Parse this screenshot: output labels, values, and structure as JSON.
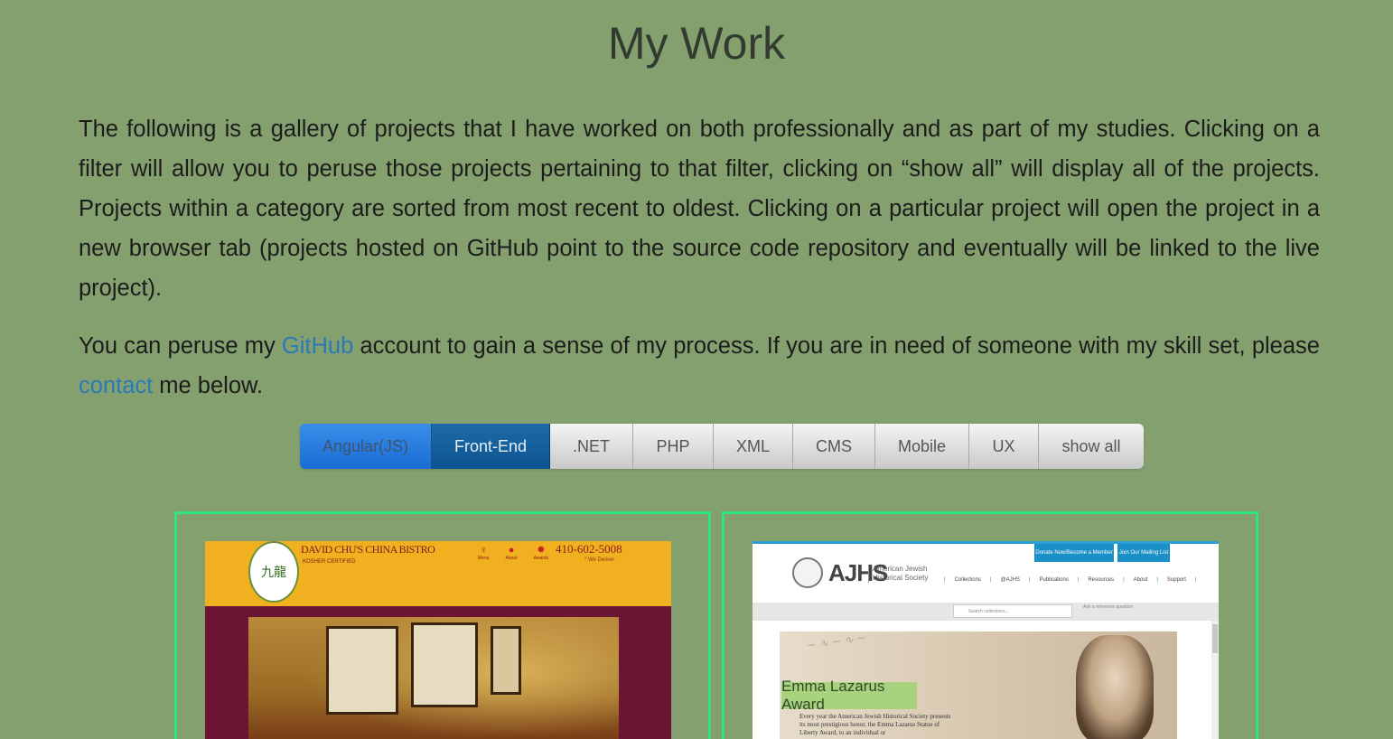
{
  "page": {
    "title": "My Work",
    "intro": "The following is a gallery of projects that I have worked on both professionally and as part of my studies. Clicking on a filter will allow you to peruse those projects pertaining to that filter, clicking on “show all” will display all of the projects. Projects within a category are sorted from most recent to oldest. Clicking on a particular project will open the project in a new browser tab (projects hosted on GitHub point to the source code repository and eventually will be linked to the live project).",
    "para2_before": "You can peruse my ",
    "para2_github": "GitHub",
    "para2_middle": " account to gain a sense of my process. If you are in need of someone with my skill set, please ",
    "para2_contact": "contact",
    "para2_after": " me below."
  },
  "filters": [
    {
      "label": "Angular(JS)",
      "state": "primary"
    },
    {
      "label": "Front-End",
      "state": "active"
    },
    {
      "label": ".NET",
      "state": "default"
    },
    {
      "label": "PHP",
      "state": "default"
    },
    {
      "label": "XML",
      "state": "default"
    },
    {
      "label": "CMS",
      "state": "default"
    },
    {
      "label": "Mobile",
      "state": "default"
    },
    {
      "label": "UX",
      "state": "default"
    },
    {
      "label": "show all",
      "state": "default"
    }
  ],
  "projects": [
    {
      "name": "DAVID CHU'S CHINA BISTRO",
      "kosher": "KOSHER CERTIFIED",
      "phone": "410-602-5008",
      "sub": "* We Deliver",
      "icons": [
        "Menu",
        "About",
        "Awards"
      ],
      "logo_glyph": "九龍"
    },
    {
      "brand": "AJHS",
      "brand_sub_1": "American Jewish",
      "brand_sub_2": "Historical Society",
      "btn_donate": "Donate Now/Become a Member",
      "btn_join": "Join Our Mailing List",
      "nav": [
        "Collections",
        "@AJHS",
        "Publications",
        "Resources",
        "About",
        "Support"
      ],
      "search_placeholder": "Search collections...",
      "reference": "Ask a reference question",
      "award_title": "Emma Lazarus Award",
      "award_text": "Every year the American Jewish Historical Society presents its most prestigious honor, the Emma Lazarus Statue of Liberty Award, to an individual or"
    }
  ],
  "colors": {
    "background": "#84a06e",
    "link": "#2a7ab8",
    "card_border": "#2ee57f",
    "filter_primary": "#1a6cd4",
    "filter_active": "#0d5490"
  }
}
